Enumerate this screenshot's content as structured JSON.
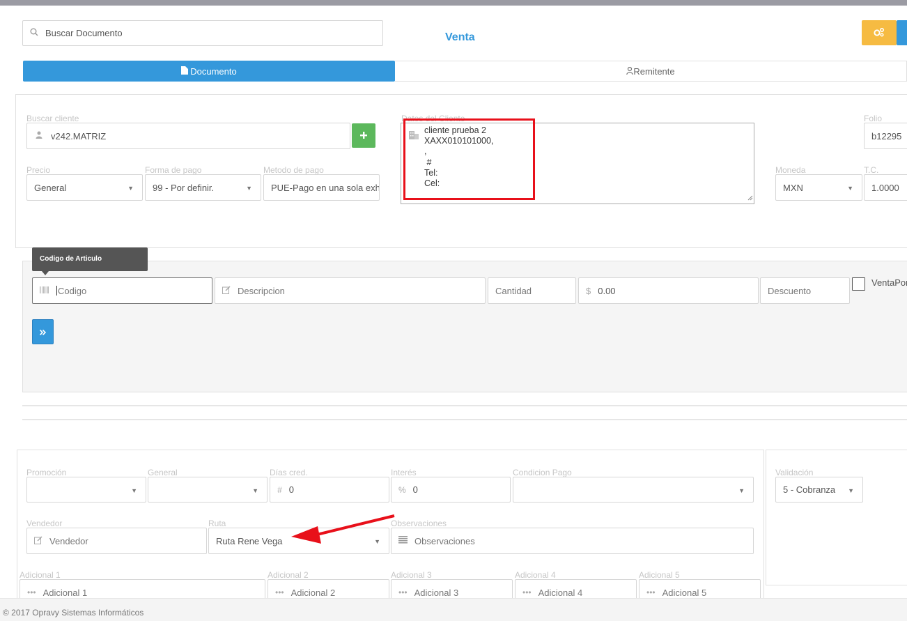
{
  "header": {
    "search_placeholder": "Buscar Documento",
    "title": "Venta"
  },
  "tabs": [
    {
      "label": "Documento",
      "icon": "file-icon",
      "active": true
    },
    {
      "label": "Remitente",
      "icon": "user-icon",
      "active": false
    }
  ],
  "client": {
    "search_label": "Buscar cliente",
    "search_value": "v242.MATRIZ",
    "data_label": "Datos del Cliente",
    "data_lines": [
      "cliente prueba 2",
      "XAXX010101000,",
      ",",
      " #",
      "Tel:",
      "Cel:"
    ],
    "folio_label": "Folio",
    "folio_value": "b12295",
    "precio_label": "Precio",
    "precio_value": "General",
    "forma_label": "Forma de pago",
    "forma_value": "99 - Por definir.",
    "metodo_label": "Metodo de pago",
    "metodo_value": "PUE-Pago en una sola exhibición",
    "moneda_label": "Moneda",
    "moneda_value": "MXN",
    "tc_label": "T.C.",
    "tc_value": "1.0000"
  },
  "articles": {
    "tooltip": "Codigo de Articulo",
    "codigo_placeholder": "Codigo",
    "descripcion_placeholder": "Descripcion",
    "cantidad_placeholder": "Cantidad",
    "precio_value": "0.00",
    "currency_symbol": "$",
    "descuento_placeholder": "Descuento",
    "venta_label": "VentaPor"
  },
  "details": {
    "promocion_label": "Promoción",
    "general_label": "General",
    "dias_label": "Días cred.",
    "dias_value": "0",
    "interes_label": "Interés",
    "interes_value": "0",
    "interes_symbol": "%",
    "dias_symbol": "#",
    "condicion_label": "Condicion Pago",
    "vendedor_label": "Vendedor",
    "vendedor_placeholder": "Vendedor",
    "ruta_label": "Ruta",
    "ruta_value": "Ruta Rene Vega",
    "observaciones_label": "Observaciones",
    "observaciones_placeholder": "Observaciones",
    "validacion_label": "Validación",
    "validacion_value": "5 - Cobranza",
    "adicionales": [
      {
        "label": "Adicional 1",
        "placeholder": "Adicional 1"
      },
      {
        "label": "Adicional 2",
        "placeholder": "Adicional 2"
      },
      {
        "label": "Adicional 3",
        "placeholder": "Adicional 3"
      },
      {
        "label": "Adicional 4",
        "placeholder": "Adicional 4"
      },
      {
        "label": "Adicional 5",
        "placeholder": "Adicional 5"
      }
    ]
  },
  "footer": {
    "copyright": "© 2017 Opravy Sistemas Informáticos"
  },
  "colors": {
    "accent_blue": "#3498db",
    "green": "#5cb85c",
    "orange": "#f6bb42",
    "annotation_red": "#e8101a"
  }
}
